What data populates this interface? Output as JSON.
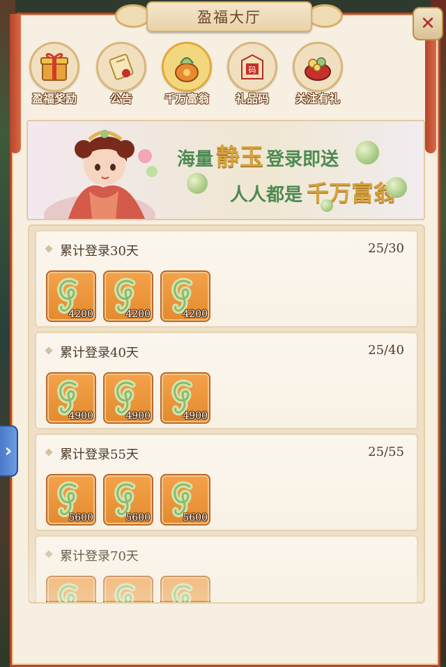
{
  "window": {
    "title": "盈福大厅"
  },
  "tabs": [
    {
      "label": "盈福奖励",
      "icon": "gift-box-icon",
      "active": false
    },
    {
      "label": "公告",
      "icon": "scroll-icon",
      "active": false
    },
    {
      "label": "千万富翁",
      "icon": "money-bag-icon",
      "active": true
    },
    {
      "label": "礼品码",
      "icon": "gift-code-icon",
      "active": false
    },
    {
      "label": "关注有礼",
      "icon": "treasure-icon",
      "active": false
    }
  ],
  "banner": {
    "line1_pre": "海量",
    "line1_hl": "静玉",
    "line1_post": "登录即送",
    "line2_pre": "人人都是",
    "line2_hl": "千万富翁"
  },
  "rewards": [
    {
      "title": "累计登录30天",
      "progress": "25/30",
      "items": [
        "4200",
        "4200",
        "4200"
      ]
    },
    {
      "title": "累计登录40天",
      "progress": "25/40",
      "items": [
        "4900",
        "4900",
        "4900"
      ]
    },
    {
      "title": "累计登录55天",
      "progress": "25/55",
      "items": [
        "5600",
        "5600",
        "5600"
      ]
    },
    {
      "title": "累计登录70天",
      "progress": "",
      "items": [
        "",
        "",
        ""
      ]
    }
  ],
  "colors": {
    "accent_red": "#b6442b",
    "panel_bg": "#f6efe2",
    "item_orange": "#e48a2f",
    "jade_green": "#9fc47c"
  }
}
